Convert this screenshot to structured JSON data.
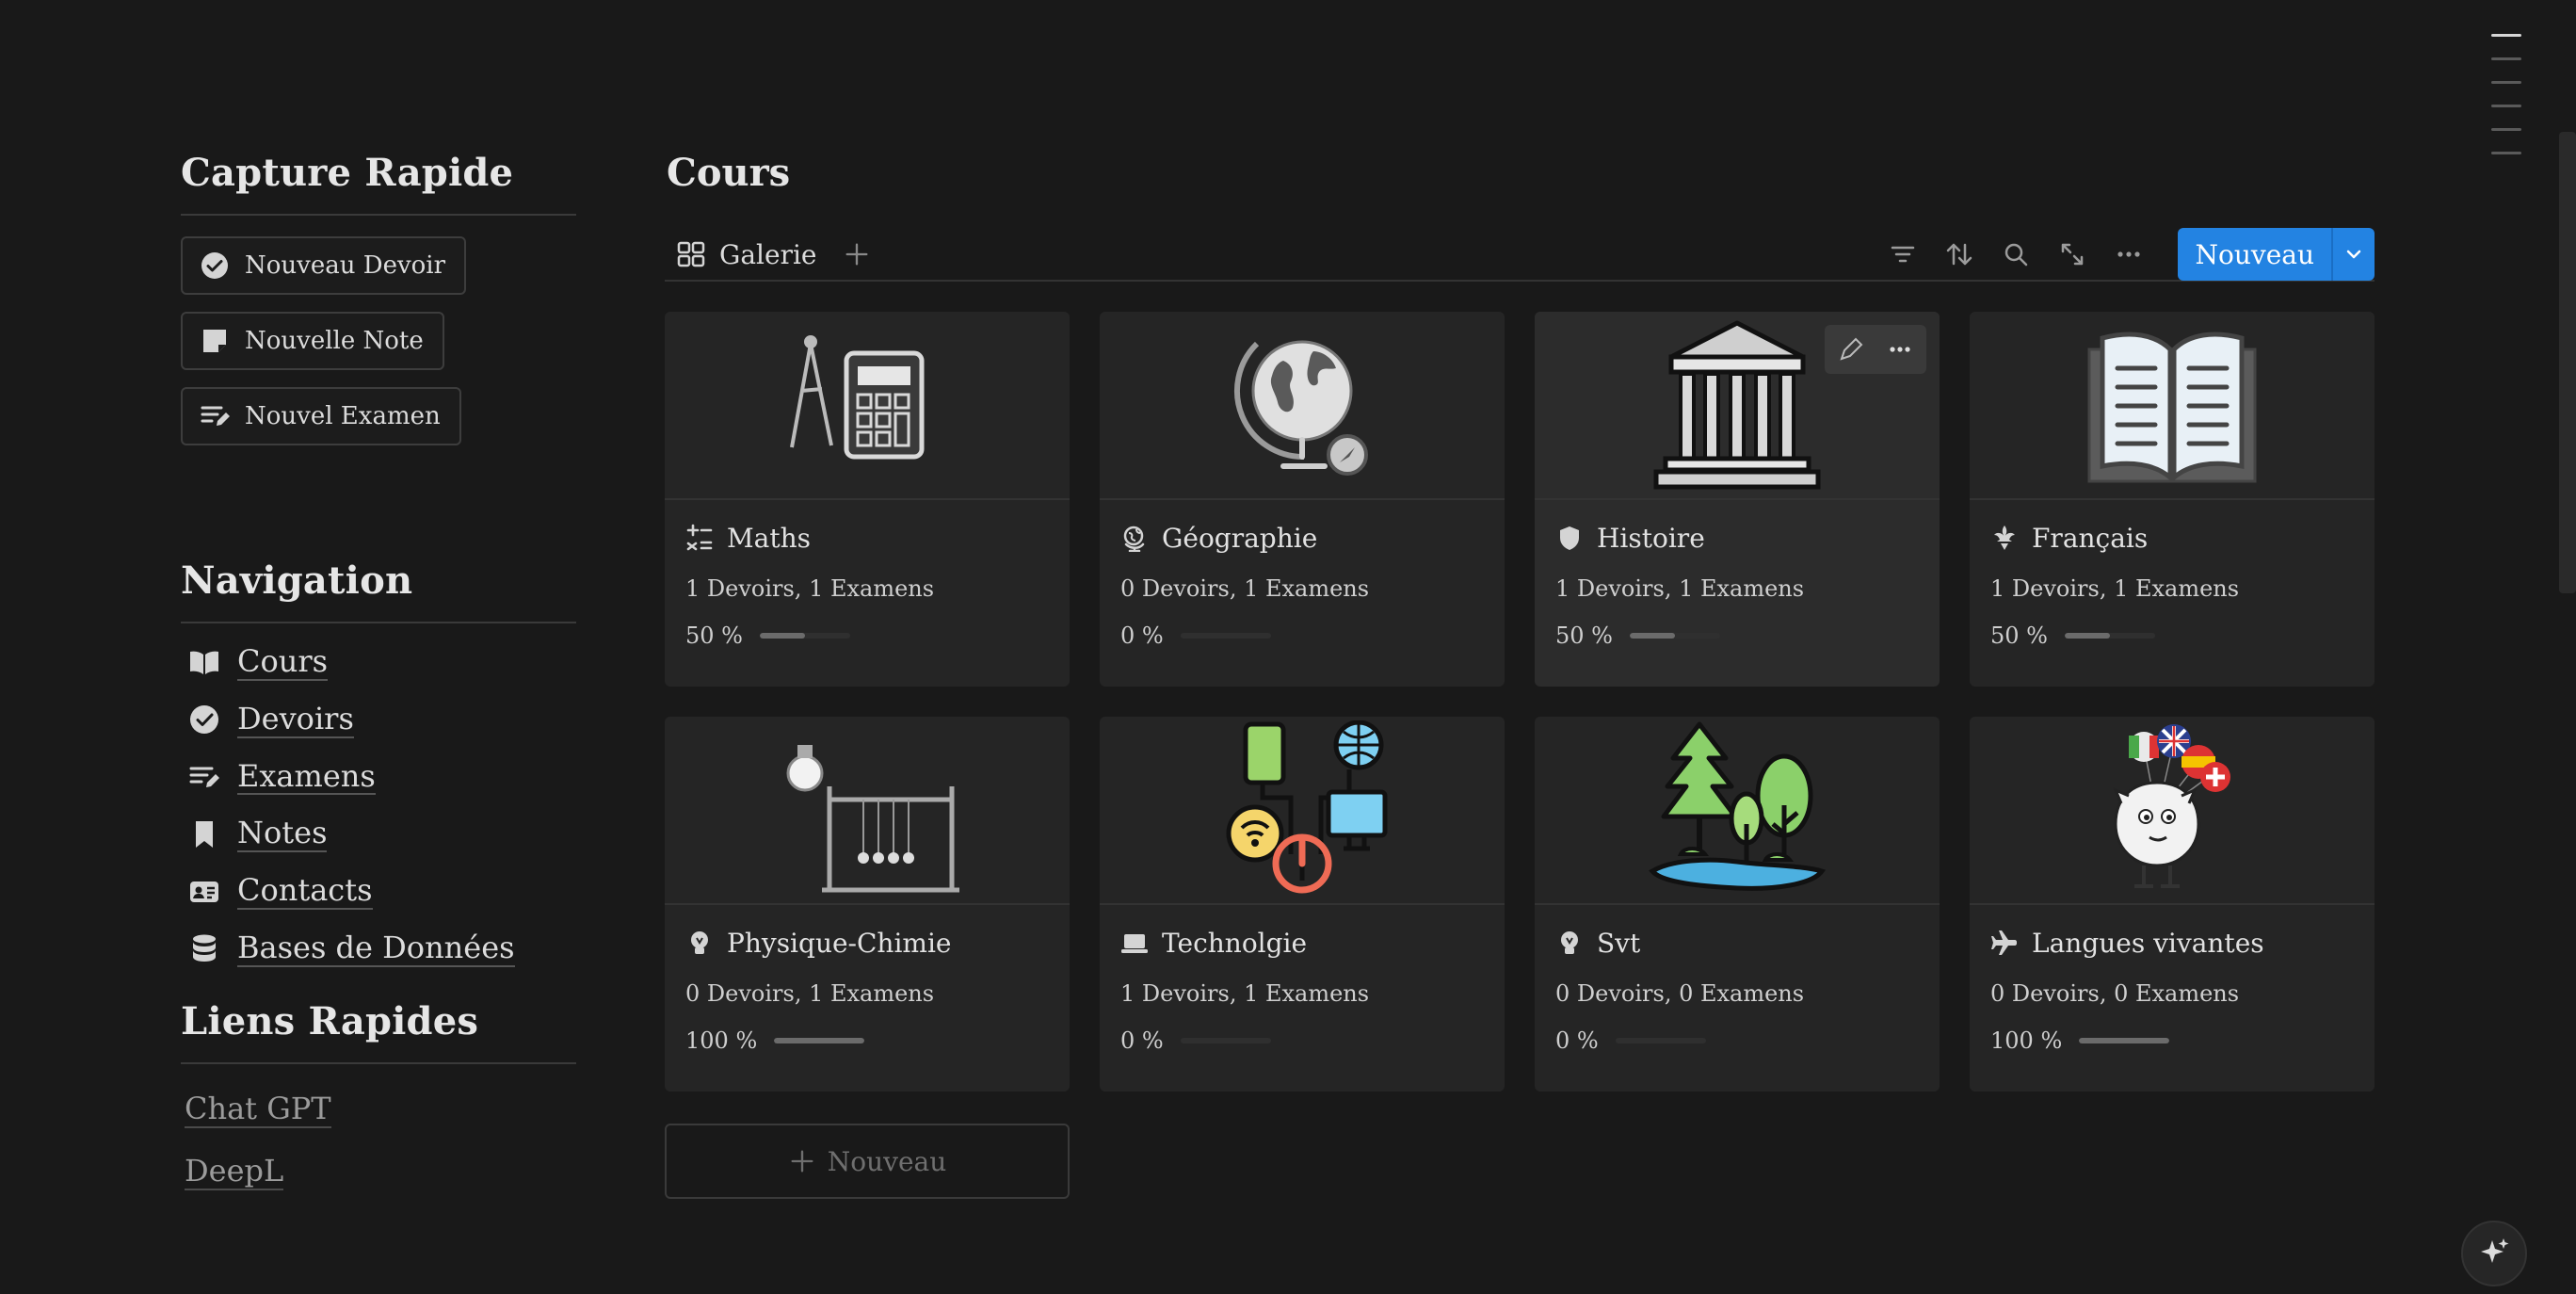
{
  "quick_capture": {
    "title": "Capture Rapide",
    "buttons": [
      {
        "label": "Nouveau Devoir",
        "icon": "check-circle-icon"
      },
      {
        "label": "Nouvelle Note",
        "icon": "sticky-note-icon"
      },
      {
        "label": "Nouvel Examen",
        "icon": "list-edit-icon"
      }
    ]
  },
  "navigation": {
    "title": "Navigation",
    "items": [
      {
        "label": "Cours",
        "icon": "book-open-icon"
      },
      {
        "label": "Devoirs",
        "icon": "check-circle-icon"
      },
      {
        "label": "Examens",
        "icon": "list-edit-icon"
      },
      {
        "label": "Notes",
        "icon": "bookmark-icon"
      },
      {
        "label": "Contacts",
        "icon": "contact-card-icon"
      },
      {
        "label": "Bases de Données",
        "icon": "database-icon"
      }
    ]
  },
  "quick_links": {
    "title": "Liens Rapides",
    "items": [
      {
        "label": "Chat GPT"
      },
      {
        "label": "DeepL"
      }
    ]
  },
  "database": {
    "title": "Cours",
    "view_tab": "Galerie",
    "new_button": "Nouveau",
    "add_card_label": "Nouveau"
  },
  "courses": [
    {
      "name": "Maths",
      "stats": "1 Devoirs, 1 Examens",
      "progress_label": "50 %",
      "progress": 0.5,
      "icon": "math-operators-icon",
      "cover": "compass-calculator"
    },
    {
      "name": "Géographie",
      "stats": "0 Devoirs, 1 Examens",
      "progress_label": "0 %",
      "progress": 0,
      "icon": "globe-icon",
      "cover": "globe"
    },
    {
      "name": "Histoire",
      "stats": "1 Devoirs, 1 Examens",
      "progress_label": "50 %",
      "progress": 0.5,
      "icon": "shield-icon",
      "cover": "temple"
    },
    {
      "name": "Français",
      "stats": "1 Devoirs, 1 Examens",
      "progress_label": "50 %",
      "progress": 0.5,
      "icon": "fleur-de-lis-icon",
      "cover": "open-book"
    },
    {
      "name": "Physique-Chimie",
      "stats": "0 Devoirs, 1 Examens",
      "progress_label": "100 %",
      "progress": 1,
      "icon": "lightbulb-icon",
      "cover": "newtons-cradle"
    },
    {
      "name": "Technolgie",
      "stats": "1 Devoirs, 1 Examens",
      "progress_label": "0 %",
      "progress": 0,
      "icon": "laptop-icon",
      "cover": "devices"
    },
    {
      "name": "Svt",
      "stats": "0 Devoirs, 0 Examens",
      "progress_label": "0 %",
      "progress": 0,
      "icon": "lightbulb-icon",
      "cover": "trees-lake"
    },
    {
      "name": "Langues vivantes",
      "stats": "0 Devoirs, 0 Examens",
      "progress_label": "100 %",
      "progress": 1,
      "icon": "airplane-icon",
      "cover": "balloons-character"
    }
  ],
  "colors": {
    "background": "#191919",
    "card": "#252525",
    "accent": "#2383e2",
    "progress_fill": "#6b6b6b"
  }
}
